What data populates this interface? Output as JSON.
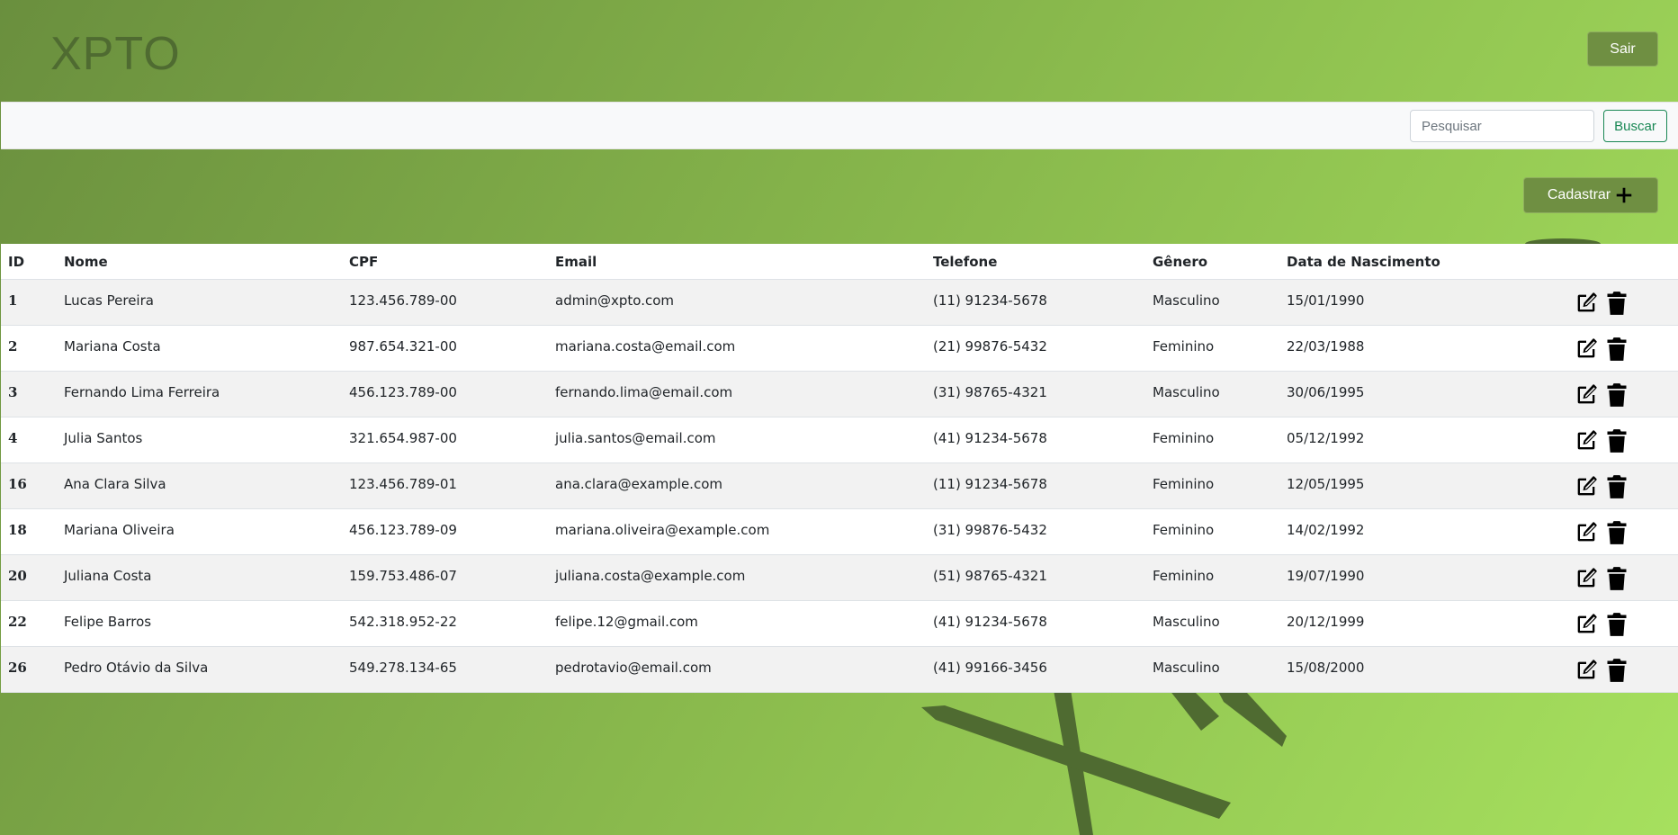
{
  "header": {
    "logo": "XPTO",
    "logout_label": "Sair"
  },
  "search": {
    "placeholder": "Pesquisar",
    "value": "",
    "button_label": "Buscar"
  },
  "actions": {
    "register_label": "Cadastrar"
  },
  "watermark": {
    "text": "XP"
  },
  "table": {
    "columns": [
      "ID",
      "Nome",
      "CPF",
      "Email",
      "Telefone",
      "Gênero",
      "Data de Nascimento",
      ""
    ],
    "rows": [
      [
        "1",
        "Lucas Pereira",
        "123.456.789-00",
        "admin@xpto.com",
        "(11) 91234-5678",
        "Masculino",
        "15/01/1990"
      ],
      [
        "2",
        "Mariana Costa",
        "987.654.321-00",
        "mariana.costa@email.com",
        "(21) 99876-5432",
        "Feminino",
        "22/03/1988"
      ],
      [
        "3",
        "Fernando Lima Ferreira",
        "456.123.789-00",
        "fernando.lima@email.com",
        "(31) 98765-4321",
        "Masculino",
        "30/06/1995"
      ],
      [
        "4",
        "Julia Santos",
        "321.654.987-00",
        "julia.santos@email.com",
        "(41) 91234-5678",
        "Feminino",
        "05/12/1992"
      ],
      [
        "16",
        "Ana Clara Silva",
        "123.456.789-01",
        "ana.clara@example.com",
        "(11) 91234-5678",
        "Feminino",
        "12/05/1995"
      ],
      [
        "18",
        "Mariana Oliveira",
        "456.123.789-09",
        "mariana.oliveira@example.com",
        "(31) 99876-5432",
        "Feminino",
        "14/02/1992"
      ],
      [
        "20",
        "Juliana Costa",
        "159.753.486-07",
        "juliana.costa@example.com",
        "(51) 98765-4321",
        "Feminino",
        "19/07/1990"
      ],
      [
        "22",
        "Felipe Barros",
        "542.318.952-22",
        "felipe.12@gmail.com",
        "(41) 91234-5678",
        "Masculino",
        "20/12/1999"
      ],
      [
        "26",
        "Pedro Otávio da Silva",
        "549.278.134-65",
        "pedrotavio@email.com",
        "(41) 99166-3456",
        "Masculino",
        "15/08/2000"
      ]
    ],
    "row_actions": [
      {
        "name": "edit-icon",
        "icon": "pencil-square"
      },
      {
        "name": "delete-icon",
        "icon": "trash"
      }
    ]
  },
  "colors": {
    "background_start": "#6a8f3e",
    "background_end": "#a6e05e",
    "button_olive": "#6f8f42",
    "logo": "#4f6b31",
    "search_button": "#198754"
  }
}
